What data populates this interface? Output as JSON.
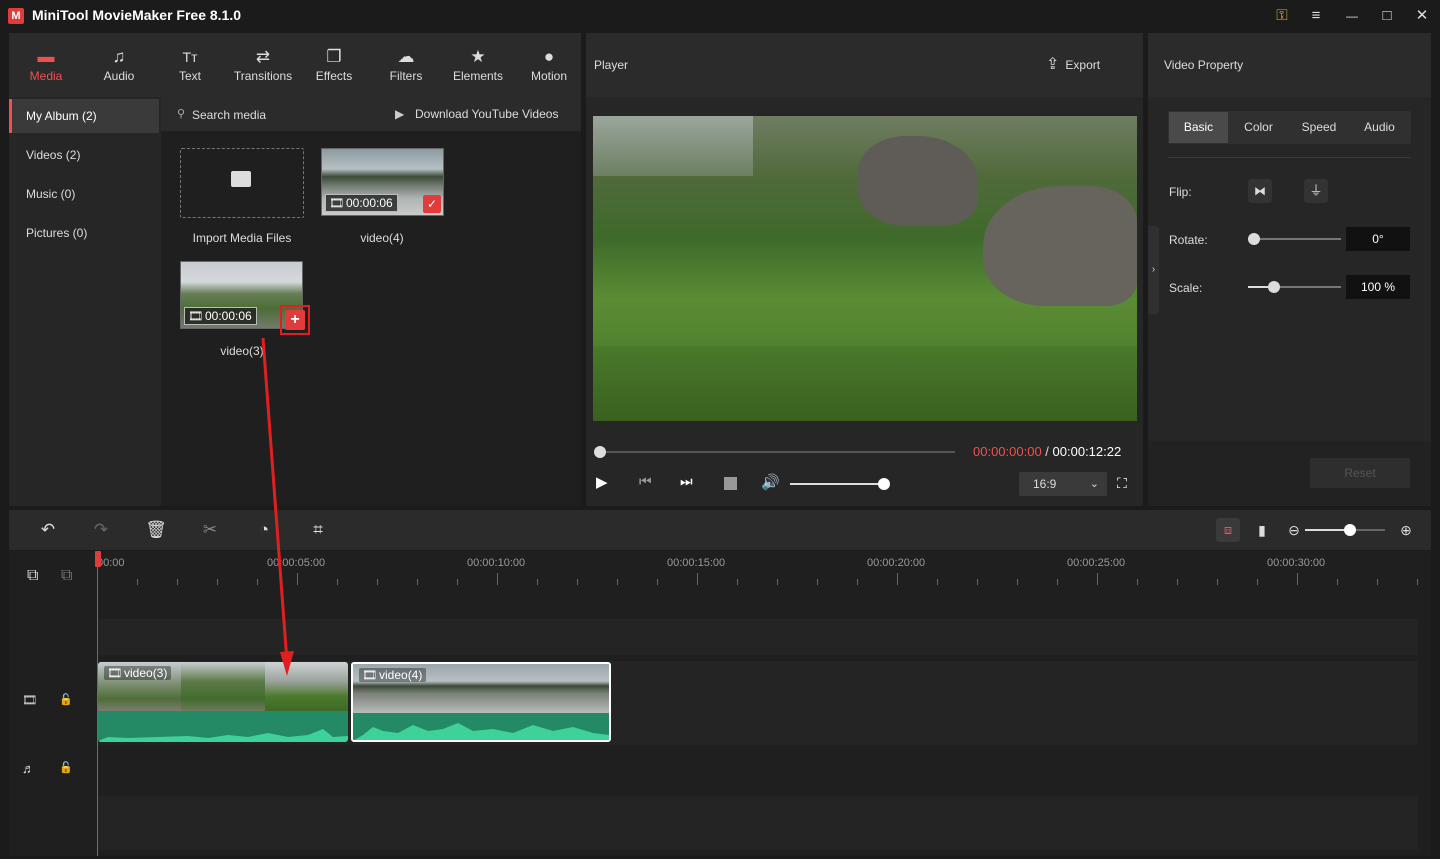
{
  "app": {
    "title": "MiniTool MovieMaker Free 8.1.0",
    "logo": "M"
  },
  "window_controls": {
    "key_icon": "key-icon",
    "menu": "≡",
    "minimize": "—",
    "maximize": "□",
    "close": "✕"
  },
  "media_tabs": [
    {
      "label": "Media",
      "icon": "▬",
      "active": true
    },
    {
      "label": "Audio",
      "icon": "♫"
    },
    {
      "label": "Text",
      "icon": "Tт"
    },
    {
      "label": "Transitions",
      "icon": "⇄"
    },
    {
      "label": "Effects",
      "icon": "❐"
    },
    {
      "label": "Filters",
      "icon": "☁"
    },
    {
      "label": "Elements",
      "icon": "★"
    },
    {
      "label": "Motion",
      "icon": "●"
    }
  ],
  "album": [
    {
      "label": "My Album (2)",
      "active": true
    },
    {
      "label": "Videos (2)"
    },
    {
      "label": "Music (0)"
    },
    {
      "label": "Pictures (0)"
    }
  ],
  "media_toolbar": {
    "search_placeholder": "Search media",
    "download_label": "Download YouTube Videos"
  },
  "media_items": [
    {
      "label": "Import Media Files"
    },
    {
      "label": "video(4)",
      "duration": "00:00:06",
      "added": true
    },
    {
      "label": "video(3)",
      "duration": "00:00:06",
      "add_button": "+"
    }
  ],
  "player": {
    "title": "Player",
    "export_label": "Export",
    "current_time": "00:00:00:00",
    "separator": " / ",
    "total_time": "00:00:12:22",
    "aspect_ratio": "16:9",
    "volume": 0.9,
    "progress": 0.0
  },
  "property": {
    "title": "Video Property",
    "tabs": [
      "Basic",
      "Color",
      "Speed",
      "Audio"
    ],
    "active_tab": "Basic",
    "flip_label": "Flip:",
    "rotate_label": "Rotate:",
    "rotate_value": "0°",
    "rotate_fraction": 0.0,
    "scale_label": "Scale:",
    "scale_value": "100 %",
    "scale_fraction": 0.27,
    "reset_label": "Reset"
  },
  "timeline": {
    "ruler": [
      "00:00",
      "00:00:05:00",
      "00:00:10:00",
      "00:00:15:00",
      "00:00:20:00",
      "00:00:25:00",
      "00:00:30:00"
    ],
    "clips": [
      {
        "label": "video(3)"
      },
      {
        "label": "video(4)"
      }
    ],
    "zoom_fraction": 0.6
  },
  "colors": {
    "accent": "#f05050",
    "audio_wave": "#248a66",
    "annotation": "#e02020"
  }
}
